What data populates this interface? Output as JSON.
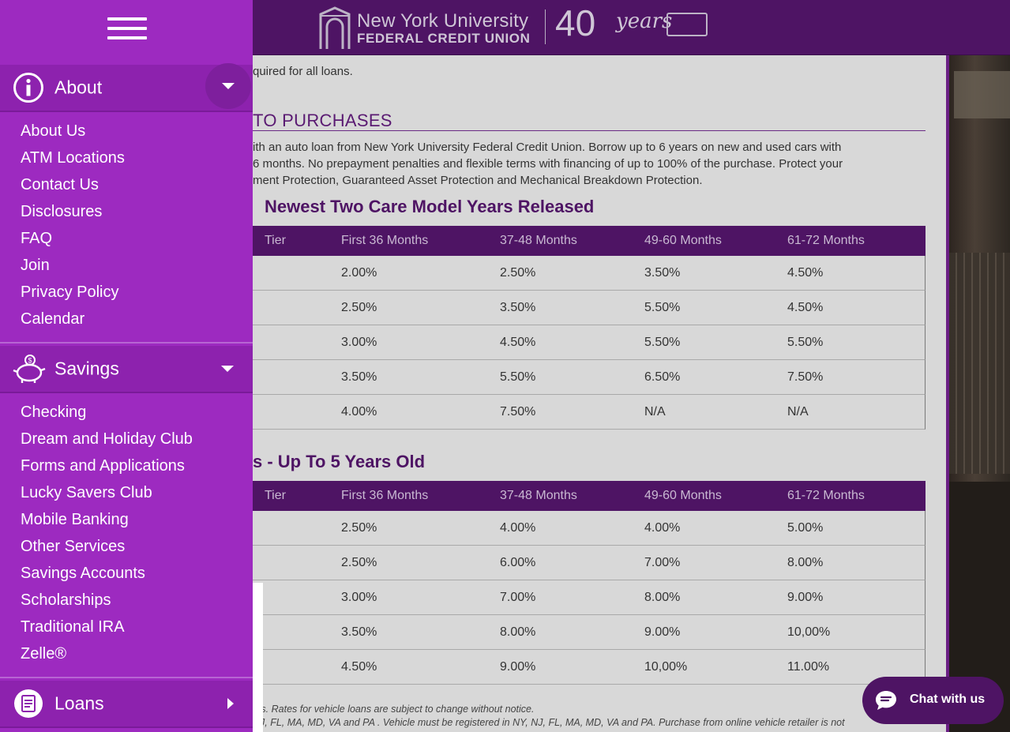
{
  "header": {
    "logo_line1": "New York University",
    "logo_line2": "FEDERAL CREDIT UNION",
    "logo_forty": "40",
    "logo_years": "years"
  },
  "content": {
    "required_line": "quired for all loans.",
    "section_title": "TO PURCHASES",
    "paragraph": [
      "ith an auto loan from New York University Federal Credit Union. Borrow up to 6 years on new and used cars with",
      "6 months. No prepayment penalties and flexible terms with financing of up to 100% of the purchase. Protect your",
      "ment Protection, Guaranteed Asset Protection and Mechanical Breakdown Protection."
    ],
    "table1": {
      "title": "Newest Two Care Model Years Released",
      "headers": [
        "Tier",
        "First 36 Months",
        "37-48 Months",
        "49-60 Months",
        "61-72 Months"
      ],
      "rows": [
        [
          "",
          "2.00%",
          "2.50%",
          "3.50%",
          "4.50%"
        ],
        [
          "",
          "2.50%",
          "3.50%",
          "5.50%",
          "4.50%"
        ],
        [
          "",
          "3.00%",
          "4.50%",
          "5.50%",
          "5.50%"
        ],
        [
          "",
          "3.50%",
          "5.50%",
          "6.50%",
          "7.50%"
        ],
        [
          "",
          "4.00%",
          "7.50%",
          "N/A",
          "N/A"
        ]
      ]
    },
    "table2": {
      "title": "s - Up To 5 Years Old",
      "headers": [
        "Tier",
        "First 36 Months",
        "37-48 Months",
        "49-60 Months",
        "61-72 Months"
      ],
      "rows": [
        [
          "",
          "2.50%",
          "4.00%",
          "4.00%",
          "5.00%"
        ],
        [
          "",
          "2.50%",
          "6.00%",
          "7.00%",
          "8.00%"
        ],
        [
          "",
          "3.00%",
          "7.00%",
          "8.00%",
          "9.00%"
        ],
        [
          "",
          "3.50%",
          "8.00%",
          "9.00%",
          "10,00%"
        ],
        [
          "",
          "4.50%",
          "9.00%",
          "10,00%",
          "11.00%"
        ]
      ]
    },
    "footnote1": "nts. Rates for vehicle loans are subject to change without notice.",
    "footnote2": "NJ, FL, MA, MD, VA and PA . Vehicle must be registered in NY, NJ, FL, MA, MD, VA and PA. Purchase from online vehicle retailer is not"
  },
  "sidebar": {
    "about": {
      "label": "About",
      "items": [
        "About Us",
        "ATM Locations",
        "Contact Us",
        "Disclosures",
        "FAQ",
        "Join",
        "Privacy Policy",
        "Calendar"
      ]
    },
    "savings": {
      "label": "Savings",
      "items": [
        "Checking",
        "Dream and Holiday Club",
        "Forms and Applications",
        "Lucky Savers Club",
        "Mobile Banking",
        "Other Services",
        "Savings Accounts",
        "Scholarships",
        "Traditional IRA",
        "Zelle®"
      ]
    },
    "loans": {
      "label": "Loans"
    }
  },
  "chat": {
    "label": "Chat with us"
  },
  "colors": {
    "brand_purple": "#4e1464",
    "menu_purple": "#9d2ac0",
    "menu_header": "#8d22ae"
  },
  "icons": [
    "hamburger-icon",
    "info-icon",
    "piggy-bank-icon",
    "loan-document-icon",
    "chevron-down-icon",
    "chevron-right-icon",
    "chat-bubble-icon"
  ]
}
